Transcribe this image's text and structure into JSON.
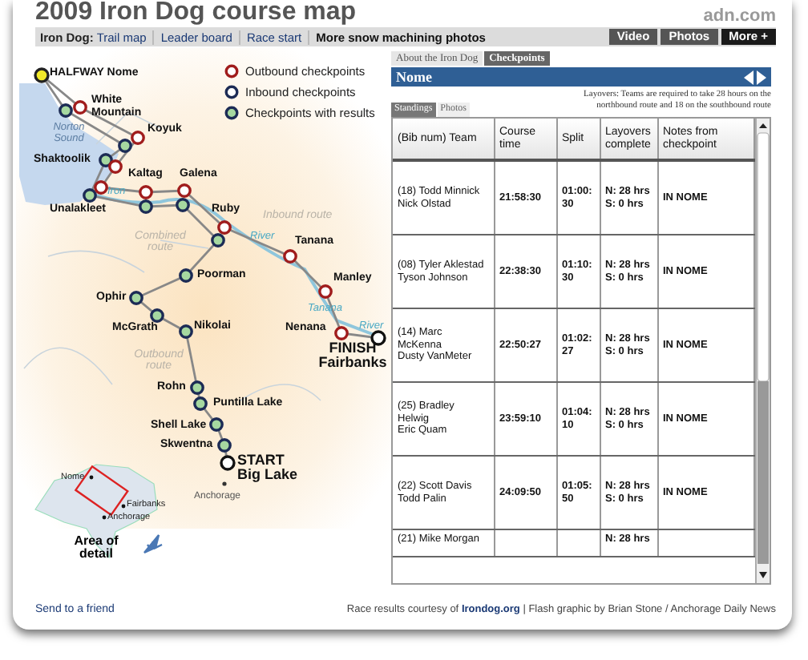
{
  "header": {
    "title": "2009 Iron Dog course map",
    "site": "adn.com"
  },
  "nav": {
    "label": "Iron Dog:",
    "links": [
      {
        "text": "Trail map",
        "bold": false
      },
      {
        "text": "Leader board",
        "bold": false
      },
      {
        "text": "Race start",
        "bold": false
      },
      {
        "text": "More snow machining photos",
        "bold": true
      }
    ],
    "buttons": [
      {
        "text": "Video",
        "kind": "plain"
      },
      {
        "text": "Photos",
        "kind": "plain"
      },
      {
        "text": "More +",
        "kind": "more"
      }
    ]
  },
  "map": {
    "legend": [
      {
        "kind": "outbound",
        "label": "Outbound checkpoints"
      },
      {
        "kind": "inbound",
        "label": "Inbound checkpoints"
      },
      {
        "kind": "results",
        "label": "Checkpoints with results"
      }
    ],
    "places": [
      {
        "name": "Nome",
        "title": "HALFWAY",
        "markers": [
          {
            "kind": "halfway"
          }
        ]
      },
      {
        "name": "White Mountain",
        "markers": [
          {
            "kind": "results"
          },
          {
            "kind": "outbound"
          }
        ]
      },
      {
        "name": "Koyuk",
        "markers": [
          {
            "kind": "results"
          },
          {
            "kind": "outbound"
          }
        ]
      },
      {
        "name": "Shaktoolik",
        "markers": [
          {
            "kind": "results"
          },
          {
            "kind": "outbound"
          }
        ]
      },
      {
        "name": "Unalakleet",
        "markers": [
          {
            "kind": "results"
          },
          {
            "kind": "outbound"
          }
        ]
      },
      {
        "name": "Kaltag",
        "markers": [
          {
            "kind": "outbound"
          },
          {
            "kind": "results"
          }
        ]
      },
      {
        "name": "Galena",
        "markers": [
          {
            "kind": "outbound"
          },
          {
            "kind": "results"
          }
        ]
      },
      {
        "name": "Ruby",
        "markers": [
          {
            "kind": "outbound"
          },
          {
            "kind": "results"
          }
        ]
      },
      {
        "name": "Tanana",
        "markers": [
          {
            "kind": "outbound"
          }
        ]
      },
      {
        "name": "Manley",
        "markers": [
          {
            "kind": "outbound"
          }
        ]
      },
      {
        "name": "Nenana",
        "markers": [
          {
            "kind": "outbound"
          }
        ]
      },
      {
        "name": "Fairbanks",
        "title": "FINISH",
        "markers": [
          {
            "kind": "finish"
          }
        ]
      },
      {
        "name": "Poorman",
        "markers": [
          {
            "kind": "results"
          }
        ]
      },
      {
        "name": "Ophir",
        "markers": [
          {
            "kind": "results"
          }
        ]
      },
      {
        "name": "McGrath",
        "markers": [
          {
            "kind": "results"
          }
        ]
      },
      {
        "name": "Nikolai",
        "markers": [
          {
            "kind": "results"
          }
        ]
      },
      {
        "name": "Rohn",
        "markers": [
          {
            "kind": "results"
          }
        ]
      },
      {
        "name": "Puntilla Lake",
        "markers": [
          {
            "kind": "results"
          }
        ]
      },
      {
        "name": "Shell Lake",
        "markers": [
          {
            "kind": "results"
          }
        ]
      },
      {
        "name": "Skwentna",
        "markers": [
          {
            "kind": "results"
          }
        ]
      },
      {
        "name": "Big Lake",
        "title": "START",
        "markers": [
          {
            "kind": "start"
          }
        ]
      },
      {
        "name": "Anchorage",
        "markers": [
          {
            "kind": "city"
          }
        ]
      }
    ],
    "annotations": [
      {
        "kind": "sea",
        "text": "Norton Sound"
      },
      {
        "kind": "river",
        "text": "Iron"
      },
      {
        "kind": "route",
        "text": "Inbound route"
      },
      {
        "kind": "river",
        "text": "River"
      },
      {
        "kind": "route",
        "text": "Combined route"
      },
      {
        "kind": "river",
        "text": "Tanana"
      },
      {
        "kind": "river",
        "text": "River"
      },
      {
        "kind": "route",
        "text": "Outbound route"
      }
    ],
    "inset": {
      "places": [
        "Nome",
        "Fairbanks",
        "Anchorage"
      ],
      "caption": "Area of detail"
    }
  },
  "panel": {
    "tabs": [
      {
        "label": "About the Iron Dog",
        "selected": false
      },
      {
        "label": "Checkpoints",
        "selected": true
      }
    ],
    "checkpoint": "Nome",
    "note": "Layovers: Teams are required to take 28 hours on the northbound route and 18 on the southbound route",
    "subtabs": [
      {
        "label": "Standings",
        "selected": true
      },
      {
        "label": "Photos",
        "selected": false
      }
    ],
    "columns": [
      "(Bib num) Team",
      "Course time",
      "Split",
      "Layovers complete",
      "Notes from checkpoint"
    ],
    "rows": [
      {
        "team": [
          "(18) Todd Minnick",
          "Nick Olstad"
        ],
        "course_time": "21:58:30",
        "split": "01:00:30",
        "layovers": [
          "N: 28 hrs",
          "S: 0 hrs"
        ],
        "notes": "IN NOME"
      },
      {
        "team": [
          "(08) Tyler Aklestad",
          "Tyson Johnson"
        ],
        "course_time": "22:38:30",
        "split": "01:10:30",
        "layovers": [
          "N: 28 hrs",
          "S: 0 hrs"
        ],
        "notes": "IN NOME"
      },
      {
        "team": [
          "(14) Marc McKenna",
          "Dusty VanMeter"
        ],
        "course_time": "22:50:27",
        "split": "01:02:27",
        "layovers": [
          "N: 28 hrs",
          "S: 0 hrs"
        ],
        "notes": "IN NOME"
      },
      {
        "team": [
          "(25) Bradley Helwig",
          "Eric Quam"
        ],
        "course_time": "23:59:10",
        "split": "01:04:10",
        "layovers": [
          "N: 28 hrs",
          "S: 0 hrs"
        ],
        "notes": "IN NOME"
      },
      {
        "team": [
          "(22) Scott Davis",
          "Todd Palin"
        ],
        "course_time": "24:09:50",
        "split": "01:05:50",
        "layovers": [
          "N: 28 hrs",
          "S: 0 hrs"
        ],
        "notes": "IN NOME"
      },
      {
        "team": [
          "(21) Mike Morgan"
        ],
        "layovers": [
          "N: 28 hrs"
        ]
      }
    ]
  },
  "footer": {
    "share": "Send to a friend",
    "credit_before": "Race results courtesy of",
    "credit_link": "Irondog.org",
    "credit_after": "| Flash graphic by Brian Stone / Anchorage Daily News"
  }
}
